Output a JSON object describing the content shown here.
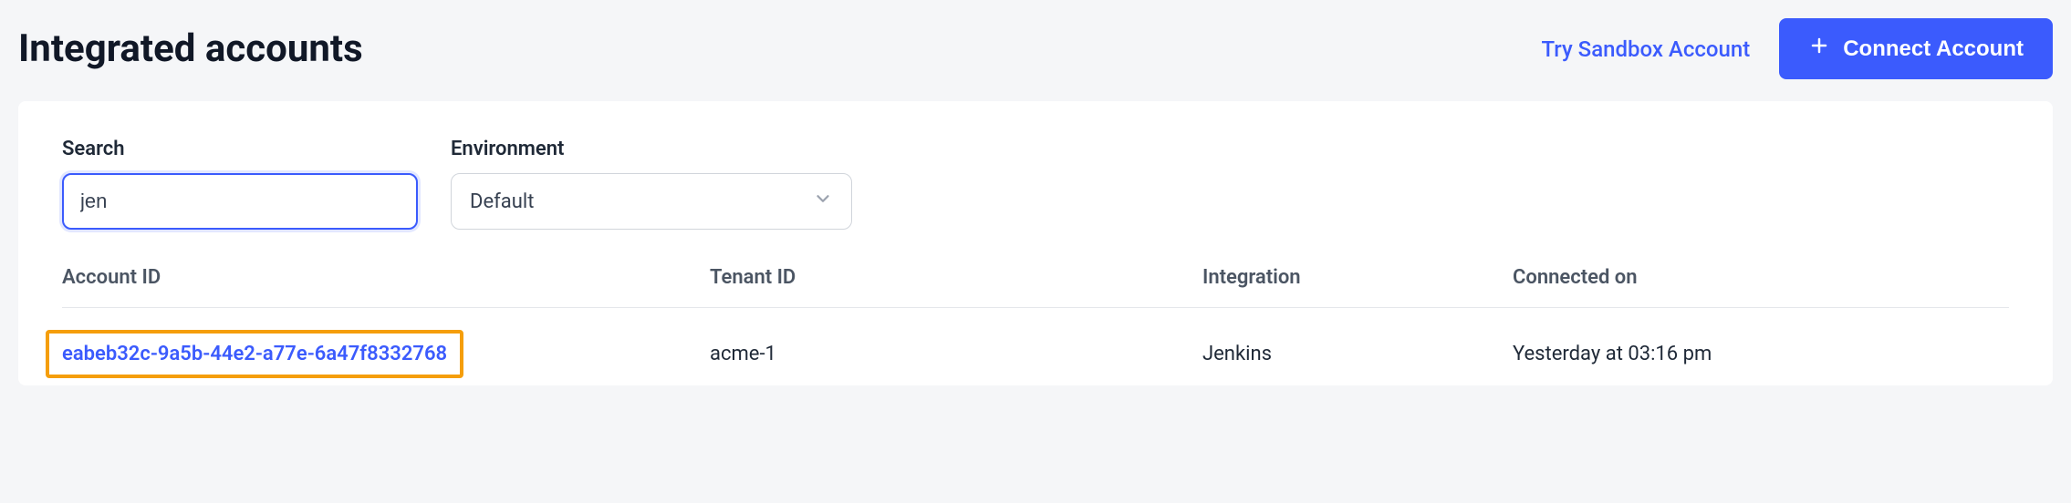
{
  "header": {
    "title": "Integrated accounts",
    "sandbox_label": "Try Sandbox Account",
    "connect_label": "Connect Account"
  },
  "filters": {
    "search": {
      "label": "Search",
      "value": "jen"
    },
    "environment": {
      "label": "Environment",
      "selected": "Default"
    }
  },
  "table": {
    "headers": {
      "account_id": "Account ID",
      "tenant_id": "Tenant ID",
      "integration": "Integration",
      "connected_on": "Connected on"
    },
    "rows": [
      {
        "account_id": "eabeb32c-9a5b-44e2-a77e-6a47f8332768",
        "tenant_id": "acme-1",
        "integration": "Jenkins",
        "connected_on": "Yesterday at 03:16 pm"
      }
    ]
  }
}
